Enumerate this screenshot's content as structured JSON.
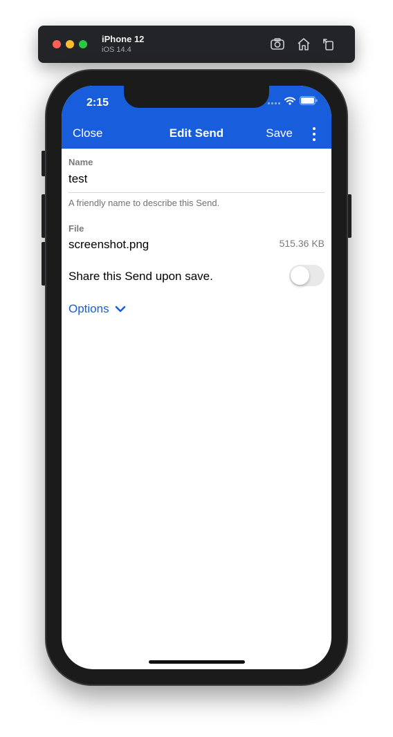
{
  "simulator": {
    "device_name": "iPhone 12",
    "os_version": "iOS 14.4",
    "tools": [
      "screenshot-icon",
      "home-icon",
      "rotate-icon"
    ]
  },
  "status_bar": {
    "time": "2:15",
    "icons": [
      "cellular-signal-icon",
      "wifi-icon",
      "battery-icon"
    ]
  },
  "nav": {
    "close_label": "Close",
    "title": "Edit Send",
    "save_label": "Save",
    "more_icon": "vertical-ellipsis-icon"
  },
  "form": {
    "name_label": "Name",
    "name_value": "test",
    "name_help": "A friendly name to describe this Send.",
    "file_label": "File",
    "file_name": "screenshot.png",
    "file_size": "515.36 KB",
    "share_label": "Share this Send upon save.",
    "share_enabled": false,
    "options_label": "Options",
    "options_icon": "chevron-down-icon"
  },
  "colors": {
    "accent": "#175ddc",
    "toggle_off": "#e9e9ea",
    "help_text": "#707070"
  }
}
